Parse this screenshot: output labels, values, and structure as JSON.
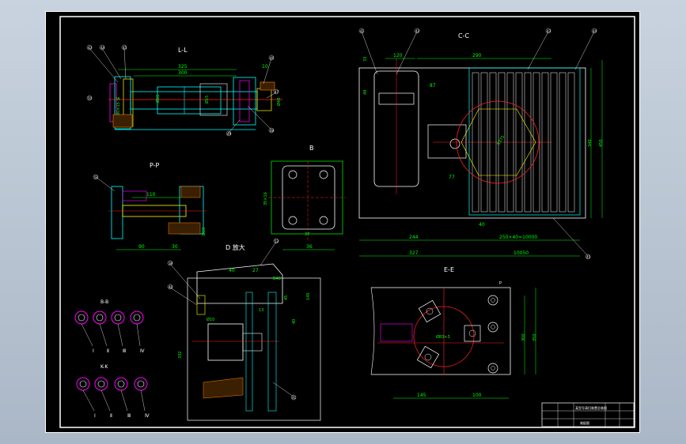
{
  "labels": {
    "view_ll": "L-L",
    "view_cc": "C-C",
    "view_pp": "P-P",
    "view_b": "B",
    "view_d": "D 放大",
    "view_ee": "E-E",
    "view_bb": "B-B",
    "view_kk": "K-K"
  },
  "dims": {
    "ll_325": "325",
    "ll_300": "300",
    "ll_10": "10",
    "ll_phi26": "Ø26",
    "ll_phi15": "Ø15",
    "ll_phi48": "Ø48",
    "ll_shaft": "30×15 深",
    "pp_110": "110",
    "pp_phi20": "Ø20",
    "pp_90": "90",
    "pp_30": "30",
    "b_36": "36",
    "b_37": "37",
    "b_side": "35×16",
    "cc_120": "120",
    "cc_290": "290",
    "cc_87": "87",
    "cc_33": "33",
    "cc_49": "49",
    "cc_77": "77",
    "cc_40": "40",
    "cc_244": "244",
    "cc_grid": "250×40=10000",
    "cc_327": "327",
    "cc_10050": "10050",
    "cc_340": "340",
    "cc_450": "450",
    "cc_arc": "R375",
    "d_40": "40",
    "d_27": "27",
    "d_b48": "B48",
    "d_145": "145",
    "d_13": "13",
    "d_phi10": "Ø10",
    "d_40b": "40",
    "d_332": "332",
    "d_45": "45",
    "ee_arc": "Ø83×3",
    "ee_pt": "P",
    "ee_145": "145",
    "ee_100": "100",
    "ee_300": "300",
    "ee_350": "350"
  },
  "roman": {
    "bb": [
      "Ⅰ",
      "Ⅱ",
      "Ⅲ",
      "Ⅳ"
    ],
    "kk": [
      "Ⅰ",
      "Ⅱ",
      "Ⅲ",
      "Ⅳ"
    ]
  },
  "balloons": {
    "ll": [
      "43",
      "44",
      "45",
      "46",
      "47",
      "48",
      "49",
      "50"
    ],
    "cc": [
      "41",
      "42",
      "43",
      "44",
      "45"
    ],
    "pp": [
      "51"
    ],
    "d": [
      "39",
      "40",
      "41",
      "52"
    ]
  },
  "title_block": {
    "drawing_name": "某型号清扫装置总装图",
    "code": "装配图"
  }
}
